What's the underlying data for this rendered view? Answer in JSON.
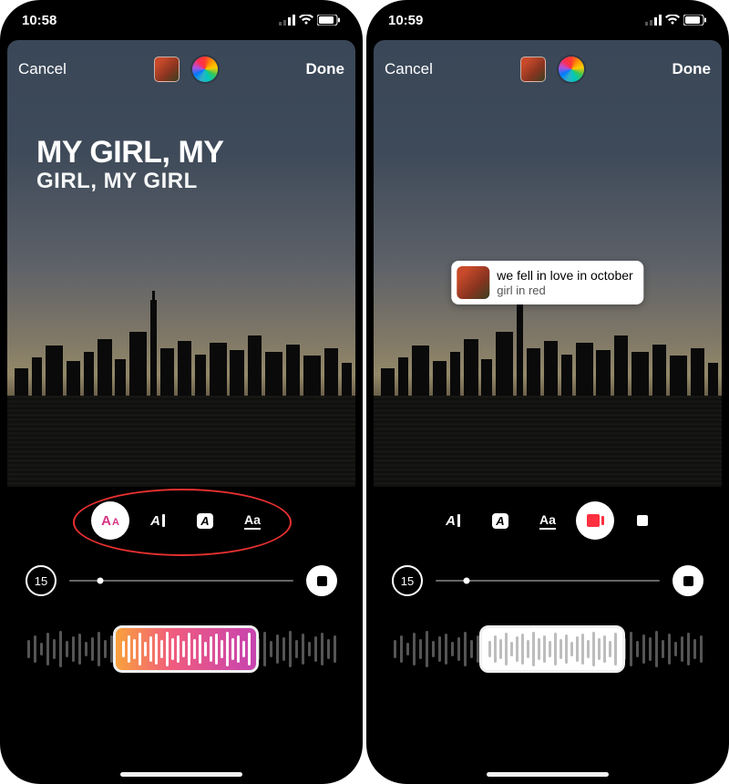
{
  "left": {
    "status_time": "10:58",
    "cancel": "Cancel",
    "done": "Done",
    "lyric_line1": "MY GIRL, MY",
    "lyric_line2": "GIRL, MY GIRL",
    "duration": "15",
    "styles": [
      {
        "name": "lyrics-style-dynamic",
        "glyph": "A",
        "selected": true
      },
      {
        "name": "lyrics-style-cursor",
        "glyph": "A",
        "selected": false
      },
      {
        "name": "lyrics-style-badge",
        "glyph": "A",
        "selected": false
      },
      {
        "name": "lyrics-style-classic",
        "glyph": "Aa",
        "selected": false
      }
    ]
  },
  "right": {
    "status_time": "10:59",
    "cancel": "Cancel",
    "done": "Done",
    "song_title": "we fell in love in october",
    "song_artist": "girl in red",
    "duration": "15",
    "styles": [
      {
        "name": "lyrics-style-cursor",
        "selected": false
      },
      {
        "name": "lyrics-style-badge",
        "selected": false
      },
      {
        "name": "lyrics-style-classic",
        "selected": false
      },
      {
        "name": "sticker-style-art",
        "selected": true
      },
      {
        "name": "sticker-style-simple",
        "selected": false
      }
    ]
  },
  "icons": {
    "signal": "signal-icon",
    "wifi": "wifi-icon",
    "battery": "battery-icon",
    "stop": "stop-icon"
  }
}
